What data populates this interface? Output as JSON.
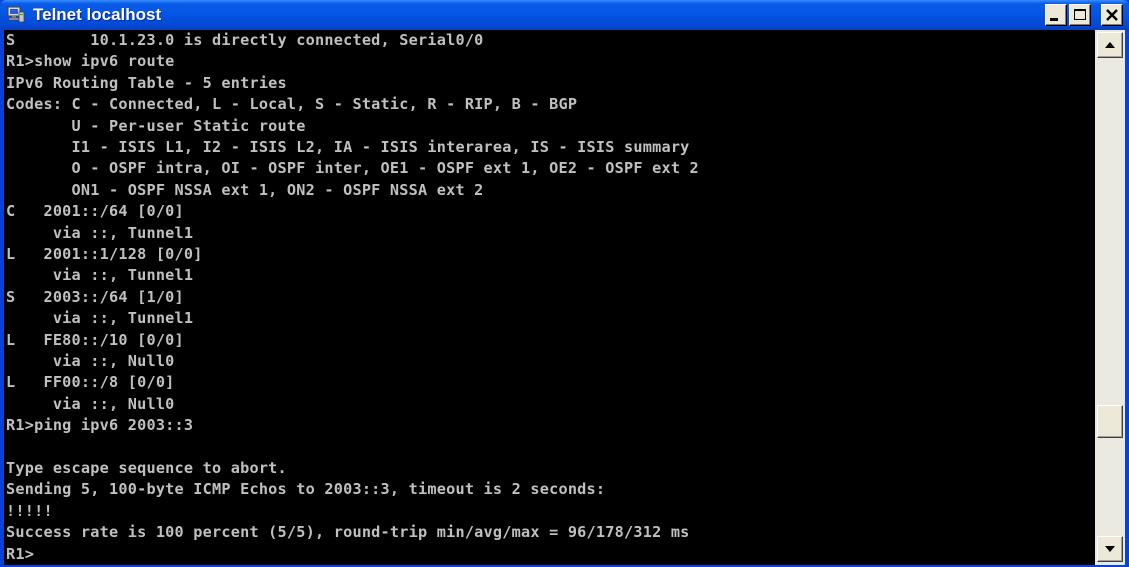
{
  "window": {
    "title": "Telnet localhost",
    "icon": "telnet-terminal-icon"
  },
  "controls": {
    "minimize_icon": "minimize-icon",
    "maximize_icon": "maximize-icon",
    "close_icon": "close-icon"
  },
  "console": {
    "lines": [
      "S        10.1.23.0 is directly connected, Serial0/0",
      "R1>show ipv6 route",
      "IPv6 Routing Table - 5 entries",
      "Codes: C - Connected, L - Local, S - Static, R - RIP, B - BGP",
      "       U - Per-user Static route",
      "       I1 - ISIS L1, I2 - ISIS L2, IA - ISIS interarea, IS - ISIS summary",
      "       O - OSPF intra, OI - OSPF inter, OE1 - OSPF ext 1, OE2 - OSPF ext 2",
      "       ON1 - OSPF NSSA ext 1, ON2 - OSPF NSSA ext 2",
      "C   2001::/64 [0/0]",
      "     via ::, Tunnel1",
      "L   2001::1/128 [0/0]",
      "     via ::, Tunnel1",
      "S   2003::/64 [1/0]",
      "     via ::, Tunnel1",
      "L   FE80::/10 [0/0]",
      "     via ::, Null0",
      "L   FF00::/8 [0/0]",
      "     via ::, Null0",
      "R1>ping ipv6 2003::3",
      "",
      "Type escape sequence to abort.",
      "Sending 5, 100-byte ICMP Echos to 2003::3, timeout is 2 seconds:",
      "!!!!!",
      "Success rate is 100 percent (5/5), round-trip min/avg/max = 96/178/312 ms",
      "R1>"
    ]
  },
  "scrollbar": {
    "up_icon": "scroll-up-arrow-icon",
    "down_icon": "scroll-down-arrow-icon",
    "position": 0.78
  }
}
